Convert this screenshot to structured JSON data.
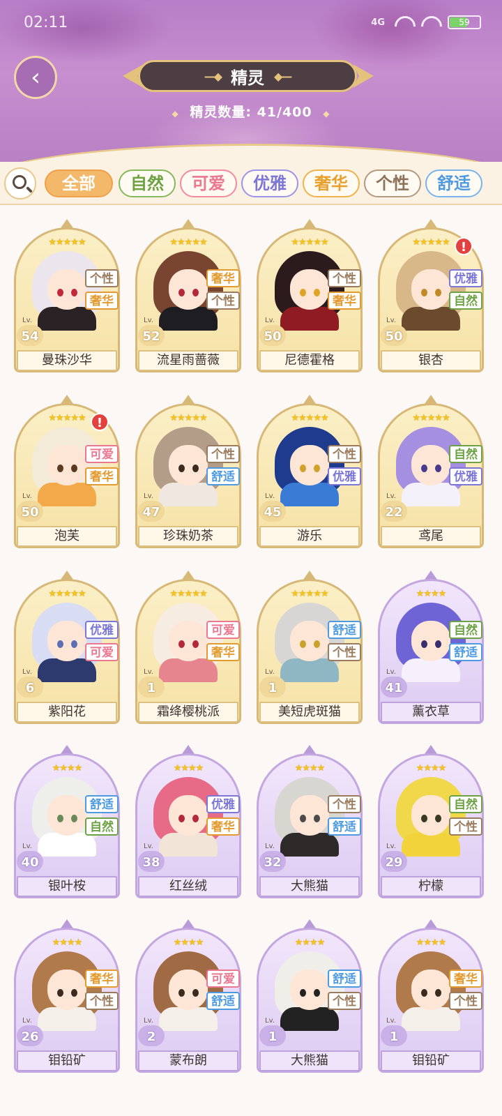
{
  "status_bar": {
    "time": "02:11",
    "signal": "4G",
    "battery": "59",
    "battery_level": 0.59
  },
  "header": {
    "title": "精灵",
    "count_label": "精灵数量: 41/400"
  },
  "filters": [
    {
      "label": "全部",
      "color": "#f0a049",
      "fill": "#f4b86a",
      "text": "#ffffff",
      "active": true
    },
    {
      "label": "自然",
      "color": "#85b95c",
      "text": "#6ca243"
    },
    {
      "label": "可爱",
      "color": "#f28aa0",
      "text": "#ec7791"
    },
    {
      "label": "优雅",
      "color": "#9b95e6",
      "text": "#7c77d6"
    },
    {
      "label": "奢华",
      "color": "#f0b24b",
      "text": "#e8a02d"
    },
    {
      "label": "个性",
      "color": "#b39a7e",
      "text": "#8c7258"
    },
    {
      "label": "舒适",
      "color": "#78b4ea",
      "text": "#4d9ae0"
    }
  ],
  "tag_colors": {
    "个性": "#9a7b5d",
    "奢华": "#e39a2f",
    "优雅": "#7c77d6",
    "自然": "#6ca243",
    "可爱": "#ec7791",
    "舒适": "#4d9ae0"
  },
  "cards": [
    {
      "name": "曼珠沙华",
      "level": "54",
      "stars": "★★★★★",
      "tags": [
        "个性",
        "奢华"
      ],
      "rarity": "gold",
      "hair": "#ebe6ee",
      "eyes": "#c3283a",
      "outfit": "#2a2224",
      "alert": false
    },
    {
      "name": "流星雨蔷薇",
      "level": "52",
      "stars": "★★★★★",
      "tags": [
        "奢华",
        "个性"
      ],
      "rarity": "gold",
      "hair": "#7a4530",
      "eyes": "#b3283a",
      "outfit": "#1e1e22",
      "alert": false
    },
    {
      "name": "尼德霍格",
      "level": "50",
      "stars": "★★★★★",
      "tags": [
        "个性",
        "奢华"
      ],
      "rarity": "gold",
      "hair": "#2b1b1d",
      "eyes": "#e0a326",
      "outfit": "#8e1c22",
      "alert": false
    },
    {
      "name": "银杏",
      "level": "50",
      "stars": "★★★★★",
      "tags": [
        "优雅",
        "自然"
      ],
      "rarity": "gold",
      "hair": "#d8b888",
      "eyes": "#c18a26",
      "outfit": "#6b4a2e",
      "alert": true
    },
    {
      "name": "泡芙",
      "level": "50",
      "stars": "★★★★★",
      "tags": [
        "可爱",
        "奢华"
      ],
      "rarity": "gold",
      "hair": "#f3ead8",
      "eyes": "#5a3a20",
      "outfit": "#f3a94a",
      "alert": true
    },
    {
      "name": "珍珠奶茶",
      "level": "47",
      "stars": "★★★★★",
      "tags": [
        "个性",
        "舒适"
      ],
      "rarity": "gold",
      "hair": "#b39c88",
      "eyes": "#3b2a20",
      "outfit": "#f0e8e0",
      "alert": false
    },
    {
      "name": "游乐",
      "level": "45",
      "stars": "★★★★★",
      "tags": [
        "个性",
        "优雅"
      ],
      "rarity": "gold",
      "hair": "#1f3b8e",
      "eyes": "#d1a22a",
      "outfit": "#3a7bd5",
      "alert": false
    },
    {
      "name": "鸢尾",
      "level": "22",
      "stars": "★★★★★",
      "tags": [
        "自然",
        "优雅"
      ],
      "rarity": "gold",
      "hair": "#a48fe0",
      "eyes": "#4a3a8e",
      "outfit": "#f5f1fb",
      "alert": false
    },
    {
      "name": "紫阳花",
      "level": "6",
      "stars": "★★★★★",
      "tags": [
        "优雅",
        "可爱"
      ],
      "rarity": "gold",
      "hair": "#d8ddf3",
      "eyes": "#5d6fb3",
      "outfit": "#2c3a6e",
      "alert": false
    },
    {
      "name": "霜绛樱桃派",
      "level": "1",
      "stars": "★★★★★",
      "tags": [
        "可爱",
        "奢华"
      ],
      "rarity": "gold",
      "hair": "#f6ece2",
      "eyes": "#b3283a",
      "outfit": "#e7858f",
      "alert": false
    },
    {
      "name": "美短虎斑猫",
      "level": "1",
      "stars": "★★★★★",
      "tags": [
        "舒适",
        "个性"
      ],
      "rarity": "gold",
      "hair": "#d8d6d4",
      "eyes": "#c9a22a",
      "outfit": "#8fb6c3",
      "alert": false
    },
    {
      "name": "薰衣草",
      "level": "41",
      "stars": "★★★★",
      "tags": [
        "自然",
        "舒适"
      ],
      "rarity": "purple",
      "hair": "#6f64d6",
      "eyes": "#3a2f6e",
      "outfit": "#f5f0fb",
      "alert": false
    },
    {
      "name": "银叶桉",
      "level": "40",
      "stars": "★★★★",
      "tags": [
        "舒适",
        "自然"
      ],
      "rarity": "purple",
      "hair": "#eeeeea",
      "eyes": "#6a8a5a",
      "outfit": "#ffffff",
      "alert": false
    },
    {
      "name": "红丝绒",
      "level": "38",
      "stars": "★★★★",
      "tags": [
        "优雅",
        "奢华"
      ],
      "rarity": "purple",
      "hair": "#e76a86",
      "eyes": "#b3283a",
      "outfit": "#f3e4d8",
      "alert": false
    },
    {
      "name": "大熊猫",
      "level": "32",
      "stars": "★★★★",
      "tags": [
        "个性",
        "舒适"
      ],
      "rarity": "purple",
      "hair": "#d8d6d0",
      "eyes": "#4a4a4a",
      "outfit": "#2e2a2a",
      "alert": false
    },
    {
      "name": "柠檬",
      "level": "29",
      "stars": "★★★★",
      "tags": [
        "自然",
        "个性"
      ],
      "rarity": "purple",
      "hair": "#f0d84a",
      "eyes": "#3a3a20",
      "outfit": "#f2d33c",
      "alert": false
    },
    {
      "name": "钼铅矿",
      "level": "26",
      "stars": "★★★★",
      "tags": [
        "奢华",
        "个性"
      ],
      "rarity": "purple",
      "hair": "#b07a4a",
      "eyes": "#3a2a20",
      "outfit": "#f4efe8",
      "alert": false
    },
    {
      "name": "蒙布朗",
      "level": "2",
      "stars": "★★★★",
      "tags": [
        "可爱",
        "舒适"
      ],
      "rarity": "purple",
      "hair": "#a06a44",
      "eyes": "#3a2a20",
      "outfit": "#f4efe8",
      "alert": false
    },
    {
      "name": "大熊猫",
      "level": "1",
      "stars": "★★★★",
      "tags": [
        "舒适",
        "个性"
      ],
      "rarity": "purple",
      "hair": "#f0eee8",
      "eyes": "#222222",
      "outfit": "#222222",
      "alert": false
    },
    {
      "name": "钼铅矿",
      "level": "1",
      "stars": "★★★★",
      "tags": [
        "奢华",
        "个性"
      ],
      "rarity": "purple",
      "hair": "#b07a4a",
      "eyes": "#3a2a20",
      "outfit": "#f4efe8",
      "alert": false
    }
  ]
}
